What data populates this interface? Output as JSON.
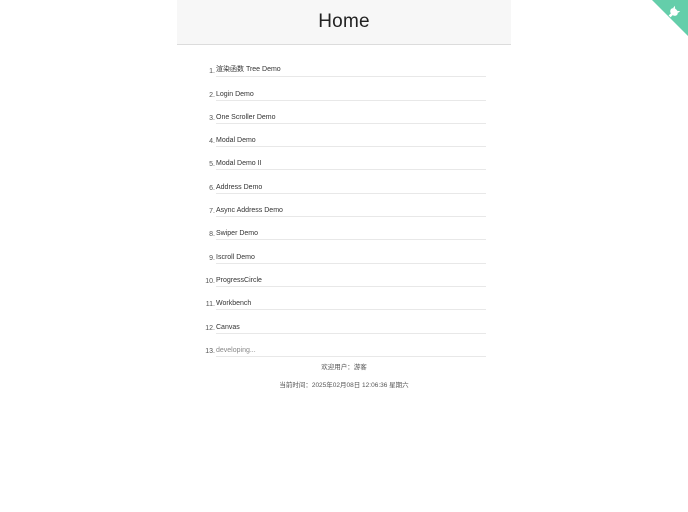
{
  "header": {
    "title": "Home"
  },
  "menu": {
    "items": [
      {
        "num": "1.",
        "label": "渲染函数 Tree Demo"
      },
      {
        "num": "2.",
        "label": "Login Demo"
      },
      {
        "num": "3.",
        "label": "One Scroller Demo"
      },
      {
        "num": "4.",
        "label": "Modal Demo"
      },
      {
        "num": "5.",
        "label": "Modal Demo II"
      },
      {
        "num": "6.",
        "label": "Address Demo"
      },
      {
        "num": "7.",
        "label": "Async Address Demo"
      },
      {
        "num": "8.",
        "label": "Swiper Demo"
      },
      {
        "num": "9.",
        "label": "Iscroll Demo"
      },
      {
        "num": "10.",
        "label": "ProgressCircle"
      },
      {
        "num": "11.",
        "label": "Workbench"
      },
      {
        "num": "12.",
        "label": "Canvas"
      },
      {
        "num": "13.",
        "label": "developing..."
      }
    ]
  },
  "footer": {
    "welcome": "欢迎用户：游客",
    "time": "当前时间：2025年02月08日 12:06:36 星期六"
  },
  "corner_ribbon": {
    "icon": "github-octocat-icon",
    "color": "#64ceaa"
  }
}
